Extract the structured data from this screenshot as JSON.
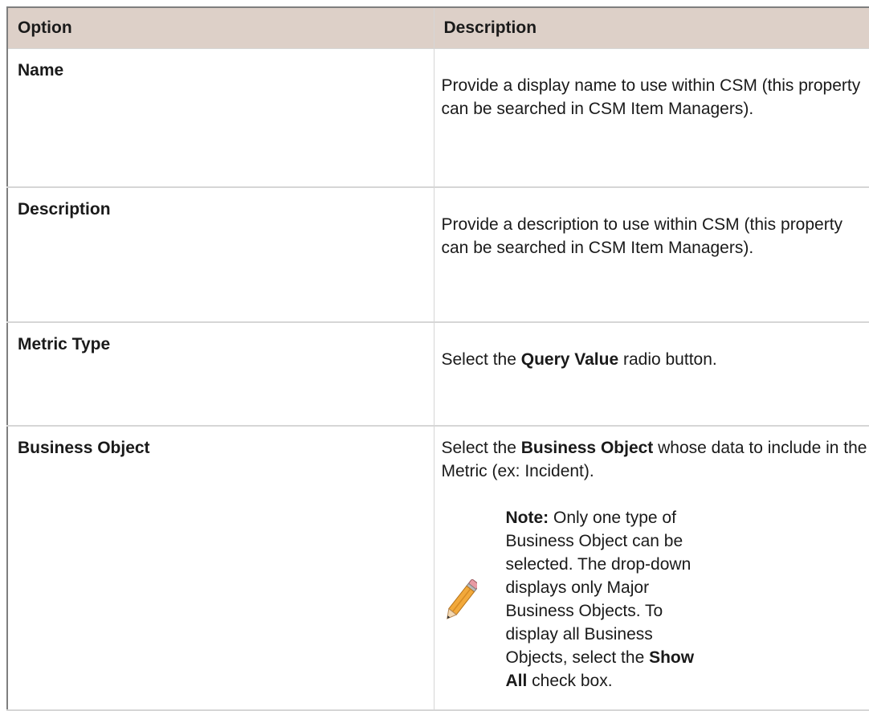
{
  "table": {
    "header": {
      "option": "Option",
      "description": "Description"
    },
    "rows": [
      {
        "option": "Name",
        "description": "Provide a display name to use within CSM (this property can be searched in CSM Item Managers)."
      },
      {
        "option": "Description",
        "description": "Provide a description to use within CSM (this property can be searched in CSM Item Managers)."
      },
      {
        "option": "Metric Type",
        "description_pre": "Select the ",
        "description_bold": "Query Value",
        "description_post": " radio button."
      },
      {
        "option": "Business Object",
        "description_pre": "Select the ",
        "description_bold": "Business Object",
        "description_post": " whose data to include in the Metric (ex: Incident).",
        "note": {
          "label": "Note:",
          "text_pre": " Only one type of Business Object can be selected. The drop-down displays only Major Business Objects. To display all Business Objects, select the ",
          "text_bold": "Show All",
          "text_post": " check box.",
          "icon": "pencil-icon"
        }
      }
    ]
  }
}
